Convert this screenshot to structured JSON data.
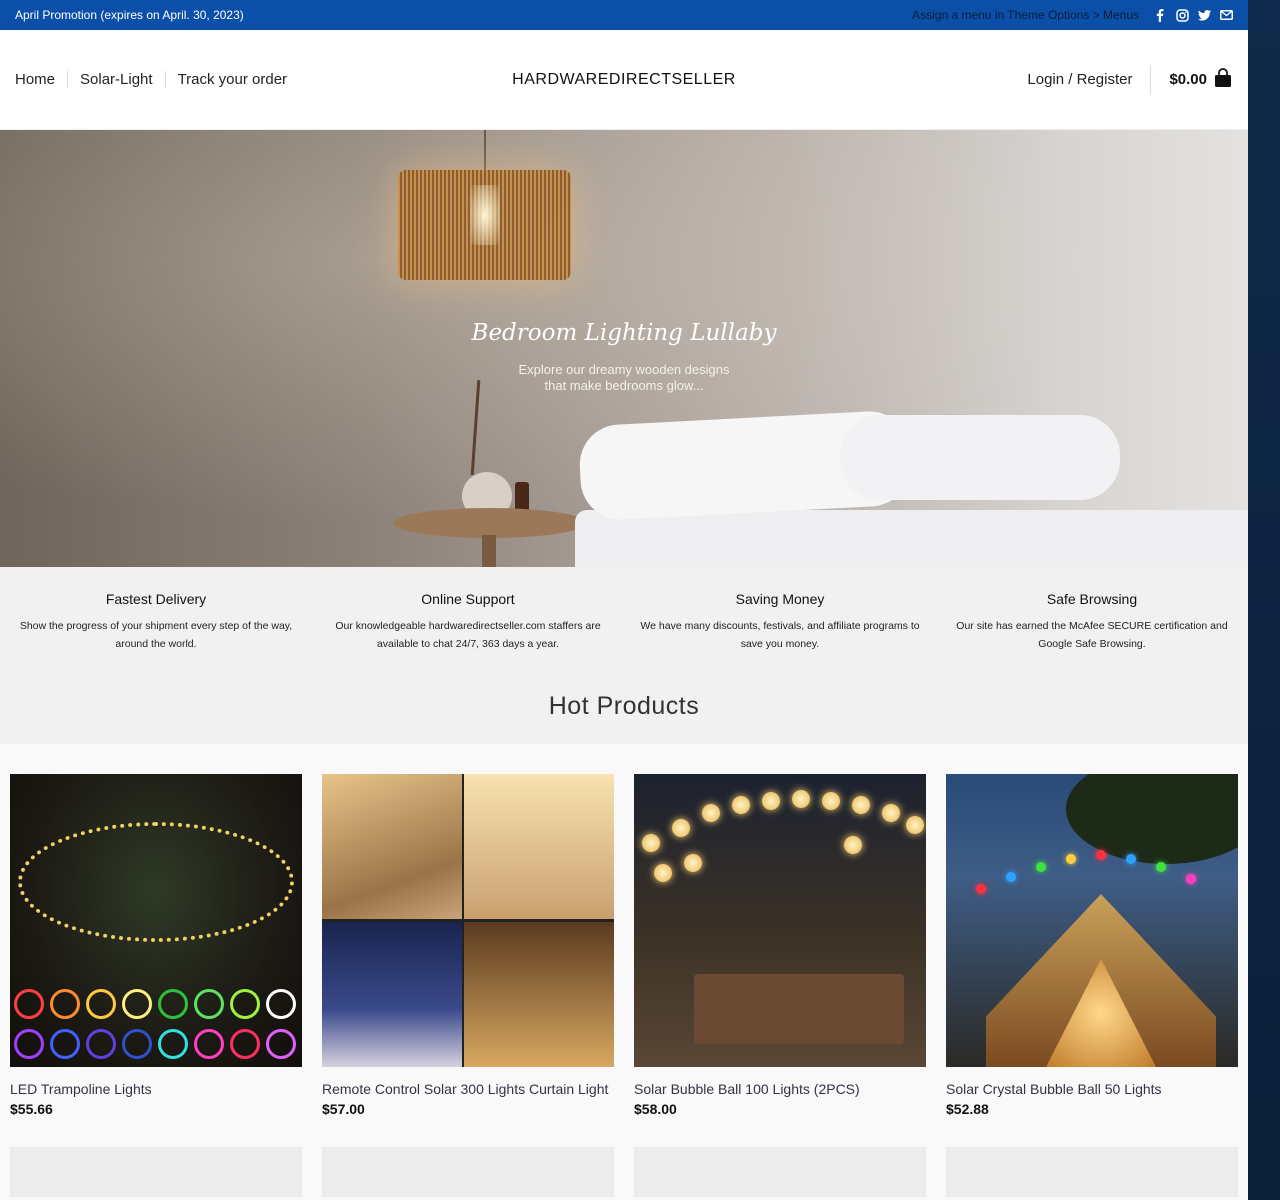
{
  "topbar": {
    "promo": "April Promotion (expires on April. 30, 2023)",
    "menu_note": "Assign a menu in Theme Options > Menus",
    "social": [
      "facebook-icon",
      "instagram-icon",
      "twitter-icon",
      "email-icon"
    ]
  },
  "header": {
    "nav": [
      "Home",
      "Solar-Light",
      "Track your order"
    ],
    "logo": "HARDWAREDIRECTSELLER",
    "login": "Login / Register",
    "cart_total": "$0.00"
  },
  "hero": {
    "title": "Bedroom Lighting Lullaby",
    "subtitle_line1": "Explore our dreamy wooden designs",
    "subtitle_line2": "that make bedrooms glow..."
  },
  "features": [
    {
      "title": "Fastest Delivery",
      "text": "Show the progress of your shipment every step of the way, around the world."
    },
    {
      "title": "Online Support",
      "text": "Our knowledgeable hardwaredirectseller.com staffers are available to chat 24/7, 363 days a year."
    },
    {
      "title": "Saving Money",
      "text": "We have many discounts, festivals, and affiliate programs to save you money."
    },
    {
      "title": "Safe Browsing",
      "text": "Our site has earned the McAfee SECURE certification and Google Safe Browsing."
    }
  ],
  "hot_products": {
    "heading": "Hot Products",
    "items": [
      {
        "name": "LED Trampoline Lights",
        "price": "$55.66"
      },
      {
        "name": "Remote Control Solar 300 Lights Curtain Light",
        "price": "$57.00"
      },
      {
        "name": "Solar Bubble Ball 100 Lights (2PCS)",
        "price": "$58.00"
      },
      {
        "name": "Solar Crystal Bubble Ball 50 Lights",
        "price": "$52.88"
      }
    ]
  },
  "colors": {
    "topbar": "#0b4fa8",
    "features_bg": "#f1f1f1",
    "page_side": "#0d2240"
  }
}
